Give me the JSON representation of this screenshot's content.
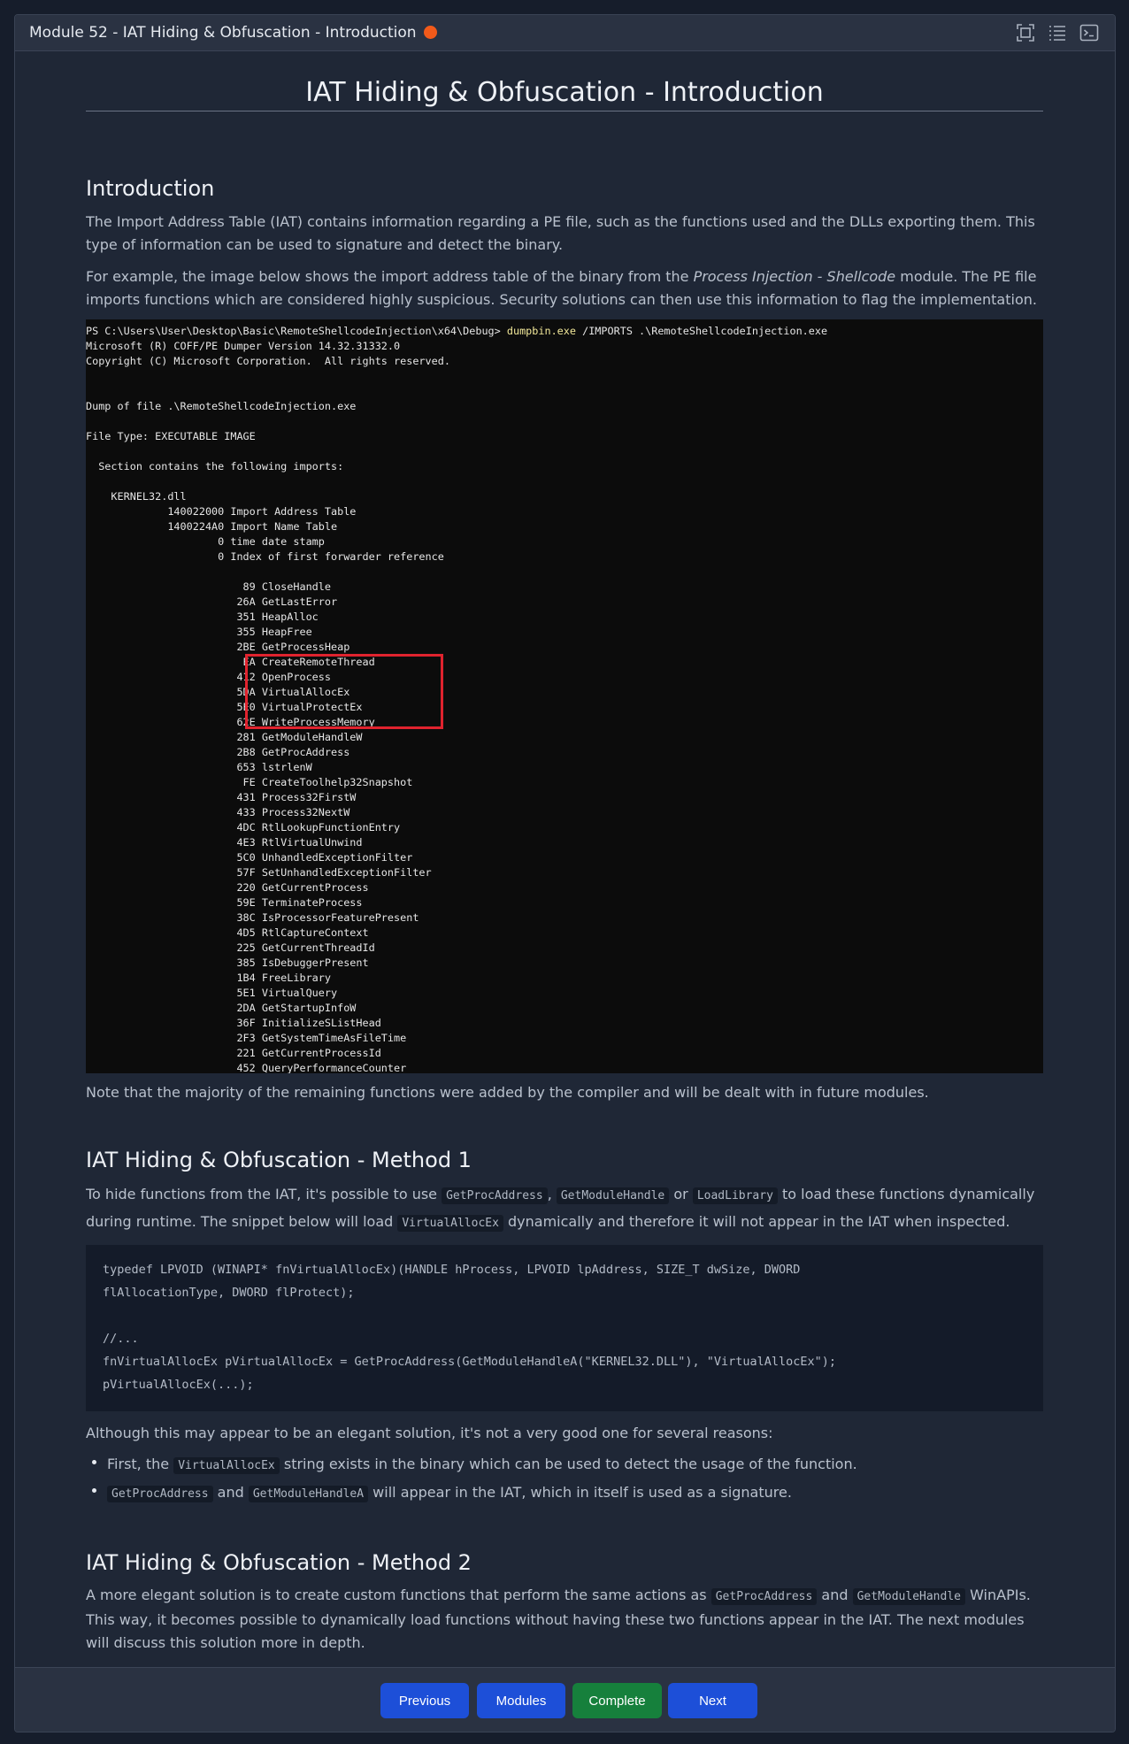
{
  "window": {
    "title": "Module 52 - IAT Hiding & Obfuscation - Introduction",
    "status_color": "#f25a1a",
    "toolbar_icons": [
      "fullscreen-icon",
      "list-icon",
      "terminal-icon"
    ]
  },
  "page_title": "IAT Hiding & Obfuscation - Introduction",
  "intro": {
    "heading": "Introduction",
    "p1": "The Import Address Table (IAT) contains information regarding a PE file, such as the functions used and the DLLs exporting them. This type of information can be used to signature and detect the binary.",
    "p2_before": "For example, the image below shows the import address table of the binary from the ",
    "p2_italic": "Process Injection - Shellcode",
    "p2_after": " module. The PE file imports functions which are considered highly suspicious. Security solutions can then use this information to flag the implementation."
  },
  "terminal": {
    "prompt": "PS C:\\Users\\User\\Desktop\\Basic\\RemoteShellcodeInjection\\x64\\Debug> ",
    "command": "dumpbin.exe",
    "args": " /IMPORTS .\\RemoteShellcodeInjection.exe",
    "header_lines": [
      "Microsoft (R) COFF/PE Dumper Version 14.32.31332.0",
      "Copyright (C) Microsoft Corporation.  All rights reserved.",
      "",
      "",
      "Dump of file .\\RemoteShellcodeInjection.exe",
      "",
      "File Type: EXECUTABLE IMAGE",
      "",
      "  Section contains the following imports:",
      "",
      "    KERNEL32.dll",
      "             140022000 Import Address Table",
      "             1400224A0 Import Name Table",
      "                     0 time date stamp",
      "                     0 Index of first forwarder reference",
      ""
    ],
    "imports": [
      [
        "89",
        "CloseHandle"
      ],
      [
        "26A",
        "GetLastError"
      ],
      [
        "351",
        "HeapAlloc"
      ],
      [
        "355",
        "HeapFree"
      ],
      [
        "2BE",
        "GetProcessHeap"
      ],
      [
        "EA",
        "CreateRemoteThread"
      ],
      [
        "412",
        "OpenProcess"
      ],
      [
        "5DA",
        "VirtualAllocEx"
      ],
      [
        "5E0",
        "VirtualProtectEx"
      ],
      [
        "62E",
        "WriteProcessMemory"
      ],
      [
        "281",
        "GetModuleHandleW"
      ],
      [
        "2B8",
        "GetProcAddress"
      ],
      [
        "653",
        "lstrlenW"
      ],
      [
        "FE",
        "CreateToolhelp32Snapshot"
      ],
      [
        "431",
        "Process32FirstW"
      ],
      [
        "433",
        "Process32NextW"
      ],
      [
        "4DC",
        "RtlLookupFunctionEntry"
      ],
      [
        "4E3",
        "RtlVirtualUnwind"
      ],
      [
        "5C0",
        "UnhandledExceptionFilter"
      ],
      [
        "57F",
        "SetUnhandledExceptionFilter"
      ],
      [
        "220",
        "GetCurrentProcess"
      ],
      [
        "59E",
        "TerminateProcess"
      ],
      [
        "38C",
        "IsProcessorFeaturePresent"
      ],
      [
        "4D5",
        "RtlCaptureContext"
      ],
      [
        "225",
        "GetCurrentThreadId"
      ],
      [
        "385",
        "IsDebuggerPresent"
      ],
      [
        "1B4",
        "FreeLibrary"
      ],
      [
        "5E1",
        "VirtualQuery"
      ],
      [
        "2DA",
        "GetStartupInfoW"
      ],
      [
        "36F",
        "InitializeSListHead"
      ],
      [
        "2F3",
        "GetSystemTimeAsFileTime"
      ],
      [
        "221",
        "GetCurrentProcessId"
      ],
      [
        "452",
        "QueryPerformanceCounter"
      ]
    ],
    "highlight_color": "#e0232e"
  },
  "note": "Note that the majority of the remaining functions were added by the compiler and will be dealt with in future modules.",
  "method1": {
    "heading": "IAT Hiding & Obfuscation - Method 1",
    "p_a": "To hide functions from the IAT, it's possible to use ",
    "code_a": "GetProcAddress",
    "p_b": ", ",
    "code_b": "GetModuleHandle",
    "p_c": " or ",
    "code_c": "LoadLibrary",
    "p_d": " to load these functions dynamically during runtime. The snippet below will load ",
    "code_d": "VirtualAllocEx",
    "p_e": " dynamically and therefore it will not appear in the IAT when inspected.",
    "code": "typedef LPVOID (WINAPI* fnVirtualAllocEx)(HANDLE hProcess, LPVOID lpAddress, SIZE_T dwSize, DWORD\nflAllocationType, DWORD flProtect);\n\n//...\nfnVirtualAllocEx pVirtualAllocEx = GetProcAddress(GetModuleHandleA(\"KERNEL32.DLL\"), \"VirtualAllocEx\");\npVirtualAllocEx(...);",
    "p2": "Although this may appear to be an elegant solution, it's not a very good one for several reasons:",
    "b1_a": "First, the ",
    "b1_code": "VirtualAllocEx",
    "b1_b": " string exists in the binary which can be used to detect the usage of the function.",
    "b2_code1": "GetProcAddress",
    "b2_a": " and ",
    "b2_code2": "GetModuleHandleA",
    "b2_b": " will appear in the IAT, which in itself is used as a signature."
  },
  "method2": {
    "heading": "IAT Hiding & Obfuscation - Method 2",
    "p_a": "A more elegant solution is to create custom functions that perform the same actions as ",
    "code_a": "GetProcAddress",
    "p_b": " and ",
    "code_b": "GetModuleHandle",
    "p_c": " WinAPIs. This way, it becomes possible to dynamically load functions without having these two functions appear in the IAT. The next modules will discuss this solution more in depth."
  },
  "footer": {
    "previous": "Previous",
    "modules": "Modules",
    "complete": "Complete",
    "next": "Next"
  }
}
